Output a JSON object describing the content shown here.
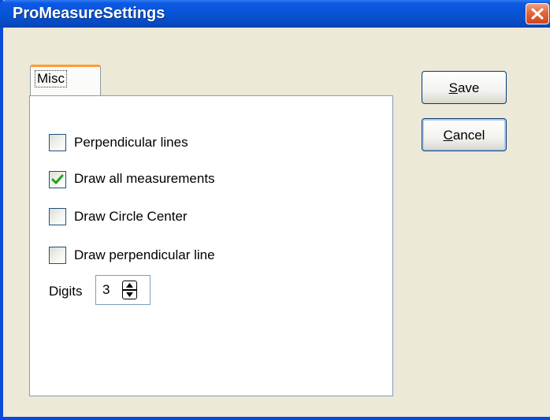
{
  "window": {
    "title": "ProMeasureSettings"
  },
  "tabs": [
    {
      "label": "Misc",
      "selected": true
    }
  ],
  "options": [
    {
      "label": "Perpendicular lines",
      "checked": false
    },
    {
      "label": "Draw all measurements",
      "checked": true
    },
    {
      "label": "Draw Circle Center",
      "checked": false
    },
    {
      "label": "Draw perpendicular line",
      "checked": false
    }
  ],
  "digits": {
    "label": "Digits",
    "value": "3"
  },
  "buttons": {
    "save": {
      "first_letter": "S",
      "rest": "ave"
    },
    "cancel": {
      "first_letter": "C",
      "rest": "ancel"
    }
  },
  "icons": {
    "close": "close-icon",
    "check": "checkmark-icon",
    "spin_up": "arrow-up-icon",
    "spin_down": "arrow-down-icon"
  },
  "colors": {
    "titlebar": "#0754d5",
    "close_button": "#e2663c",
    "dialog_bg": "#ece9d8",
    "tab_highlight": "#ff9c33",
    "checkmark": "#21a121"
  }
}
